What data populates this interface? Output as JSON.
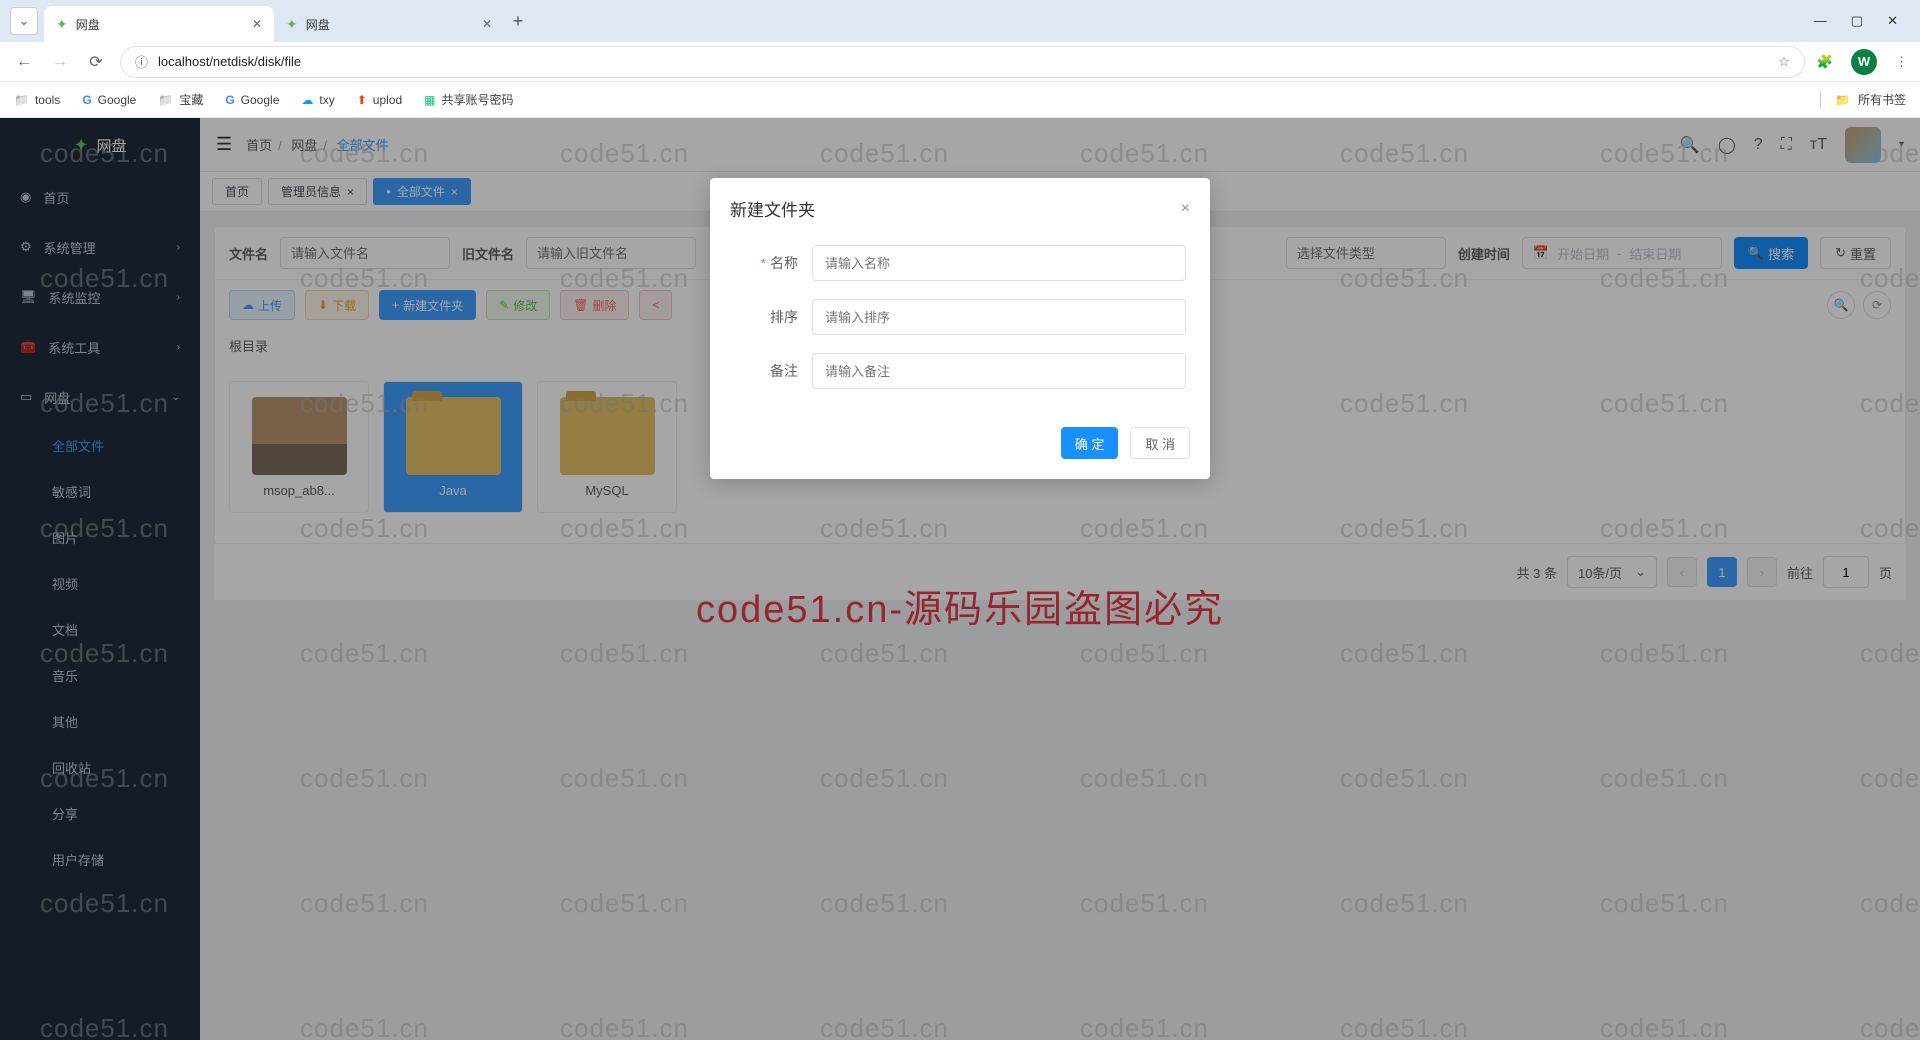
{
  "browser": {
    "tabs": [
      {
        "title": "网盘",
        "active": true
      },
      {
        "title": "网盘",
        "active": false
      }
    ],
    "url": "localhost/netdisk/disk/file",
    "bookmarks": [
      "tools",
      "Google",
      "宝藏",
      "Google",
      "txy",
      "uplod",
      "共享账号密码"
    ],
    "all_bookmarks": "所有书签",
    "avatar_letter": "W"
  },
  "sidebar": {
    "logo": "网盘",
    "items": [
      {
        "icon": "◉",
        "label": "首页"
      },
      {
        "icon": "⚙",
        "label": "系统管理",
        "chevron": "›"
      },
      {
        "icon": "🖥",
        "label": "系统监控",
        "chevron": "›"
      },
      {
        "icon": "🧰",
        "label": "系统工具",
        "chevron": "›"
      },
      {
        "icon": "▭",
        "label": "网盘",
        "chevron": "⌄",
        "expanded": true
      }
    ],
    "subitems": [
      "全部文件",
      "敏感词",
      "图片",
      "视频",
      "文档",
      "音乐",
      "其他",
      "回收站",
      "分享",
      "用户存储"
    ]
  },
  "topbar": {
    "breadcrumb": [
      "首页",
      "网盘",
      "全部文件"
    ]
  },
  "page_tabs": [
    {
      "label": "首页"
    },
    {
      "label": "管理员信息",
      "closable": true
    },
    {
      "label": "全部文件",
      "active": true,
      "closable": true
    }
  ],
  "search": {
    "filename_label": "文件名",
    "filename_ph": "请输入文件名",
    "oldname_label": "旧文件名",
    "oldname_ph": "请输入旧文件名",
    "type_ph": "选择文件类型",
    "createtime_label": "创建时间",
    "start_ph": "开始日期",
    "end_ph": "结束日期",
    "search_btn": "搜索",
    "reset_btn": "重置"
  },
  "toolbar": {
    "upload": "上传",
    "download": "下载",
    "newfolder": "新建文件夹",
    "edit": "修改",
    "delete": "删除"
  },
  "path": "根目录",
  "files": [
    {
      "name": "msop_ab8...",
      "type": "image"
    },
    {
      "name": "Java",
      "type": "folder",
      "selected": true
    },
    {
      "name": "MySQL",
      "type": "folder"
    }
  ],
  "pagination": {
    "total_text": "共 3 条",
    "per_page": "10条/页",
    "current": "1",
    "goto_label": "前往",
    "goto_value": "1",
    "page_suffix": "页"
  },
  "modal": {
    "title": "新建文件夹",
    "name_label": "名称",
    "name_ph": "请输入名称",
    "sort_label": "排序",
    "sort_ph": "请输入排序",
    "remark_label": "备注",
    "remark_ph": "请输入备注",
    "ok": "确 定",
    "cancel": "取 消"
  },
  "watermark": {
    "text": "code51.cn",
    "red": "code51.cn-源码乐园盗图必究"
  }
}
